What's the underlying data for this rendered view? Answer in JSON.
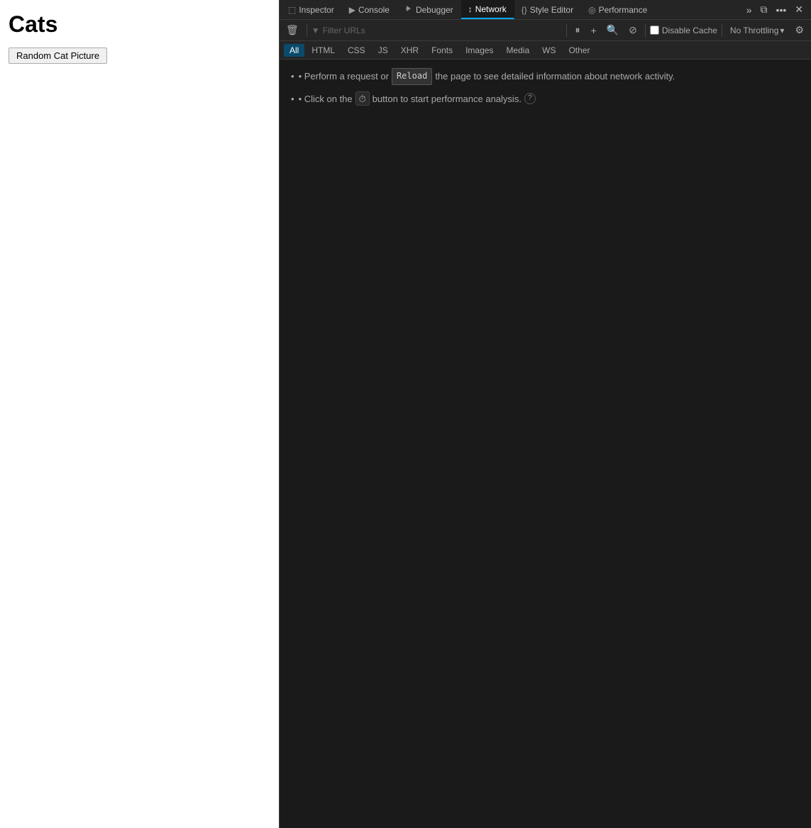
{
  "webpage": {
    "title": "Cats",
    "button_label": "Random Cat Picture"
  },
  "devtools": {
    "tabs": [
      {
        "id": "inspector",
        "label": "Inspector",
        "icon": "⬚",
        "active": false
      },
      {
        "id": "console",
        "label": "Console",
        "icon": "▶",
        "active": false
      },
      {
        "id": "debugger",
        "label": "Debugger",
        "icon": "⚙",
        "active": false
      },
      {
        "id": "network",
        "label": "Network",
        "icon": "↕",
        "active": true
      },
      {
        "id": "style-editor",
        "label": "Style Editor",
        "icon": "{}",
        "active": false
      },
      {
        "id": "performance",
        "label": "Performance",
        "icon": "◎",
        "active": false
      }
    ],
    "tab_actions": {
      "more": "»",
      "dock": "⧉",
      "ellipsis": "•••",
      "close": "✕"
    },
    "toolbar": {
      "trash_icon": "🗑",
      "filter_placeholder": "Filter URLs",
      "pause_icon": "⏸",
      "add_icon": "+",
      "search_icon": "🔍",
      "block_icon": "⊘",
      "disable_cache_label": "Disable Cache",
      "throttle_label": "No Throttling",
      "gear_icon": "⚙"
    },
    "type_filters": [
      {
        "label": "All",
        "active": true
      },
      {
        "label": "HTML",
        "active": false
      },
      {
        "label": "CSS",
        "active": false
      },
      {
        "label": "JS",
        "active": false
      },
      {
        "label": "XHR",
        "active": false
      },
      {
        "label": "Fonts",
        "active": false
      },
      {
        "label": "Images",
        "active": false
      },
      {
        "label": "Media",
        "active": false
      },
      {
        "label": "WS",
        "active": false
      },
      {
        "label": "Other",
        "active": false
      }
    ],
    "info_line1_before": "• Perform a request or",
    "info_line1_reload": "Reload",
    "info_line1_after": "the page to see detailed information about network activity.",
    "info_line2_before": "• Click on the",
    "info_line2_after": "button to start performance analysis.",
    "perf_icon": "⏱"
  }
}
